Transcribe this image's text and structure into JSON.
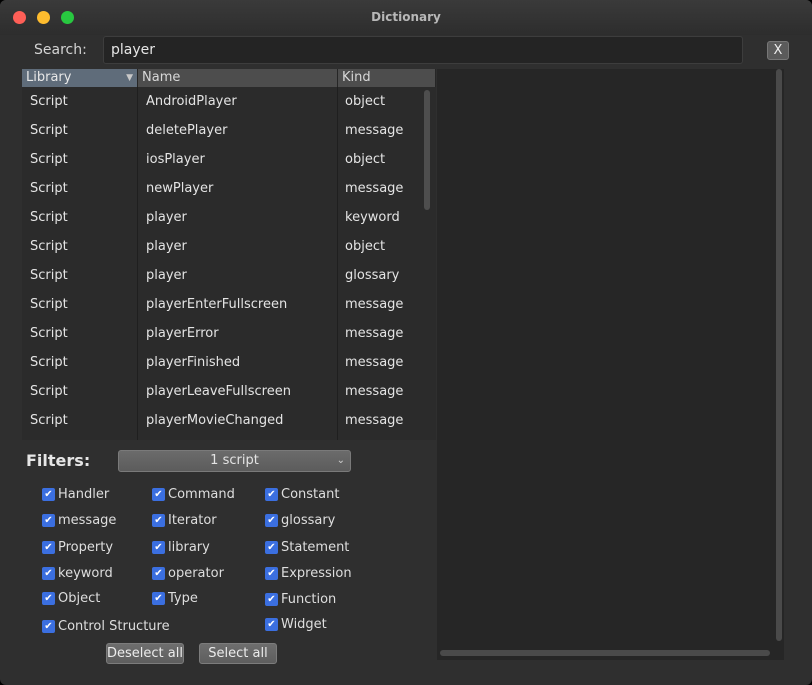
{
  "window": {
    "title": "Dictionary"
  },
  "search": {
    "label": "Search:",
    "value": "player",
    "clear_label": "X"
  },
  "table": {
    "columns": [
      "Library",
      "Name",
      "Kind"
    ],
    "sort_indicator": "▼",
    "rows": [
      {
        "library": "Script",
        "name": "AndroidPlayer",
        "kind": "object"
      },
      {
        "library": "Script",
        "name": "deletePlayer",
        "kind": "message"
      },
      {
        "library": "Script",
        "name": "iosPlayer",
        "kind": "object"
      },
      {
        "library": "Script",
        "name": "newPlayer",
        "kind": "message"
      },
      {
        "library": "Script",
        "name": "player",
        "kind": "keyword"
      },
      {
        "library": "Script",
        "name": "player",
        "kind": "object"
      },
      {
        "library": "Script",
        "name": "player",
        "kind": "glossary"
      },
      {
        "library": "Script",
        "name": "playerEnterFullscreen",
        "kind": "message"
      },
      {
        "library": "Script",
        "name": "playerError",
        "kind": "message"
      },
      {
        "library": "Script",
        "name": "playerFinished",
        "kind": "message"
      },
      {
        "library": "Script",
        "name": "playerLeaveFullscreen",
        "kind": "message"
      },
      {
        "library": "Script",
        "name": "playerMovieChanged",
        "kind": "message"
      }
    ]
  },
  "filters": {
    "label": "Filters:",
    "scope_value": "1 script",
    "checkboxes": [
      {
        "label": "Handler",
        "checked": true
      },
      {
        "label": "message",
        "checked": true
      },
      {
        "label": "Property",
        "checked": true
      },
      {
        "label": "keyword",
        "checked": true
      },
      {
        "label": "Object",
        "checked": true
      },
      {
        "label": "Control Structure",
        "checked": true
      },
      {
        "label": "Command",
        "checked": true
      },
      {
        "label": "Iterator",
        "checked": true
      },
      {
        "label": "library",
        "checked": true
      },
      {
        "label": "operator",
        "checked": true
      },
      {
        "label": "Type",
        "checked": true
      },
      {
        "label": "Constant",
        "checked": true
      },
      {
        "label": "glossary",
        "checked": true
      },
      {
        "label": "Statement",
        "checked": true
      },
      {
        "label": "Expression",
        "checked": true
      },
      {
        "label": "Function",
        "checked": true
      },
      {
        "label": "Widget",
        "checked": true
      }
    ],
    "deselect_all_label": "Deselect all",
    "select_all_label": "Select all"
  },
  "colors": {
    "accent": "#3b6fe0",
    "background": "#2f2f2f",
    "header_selected": "#5f6c7a"
  }
}
